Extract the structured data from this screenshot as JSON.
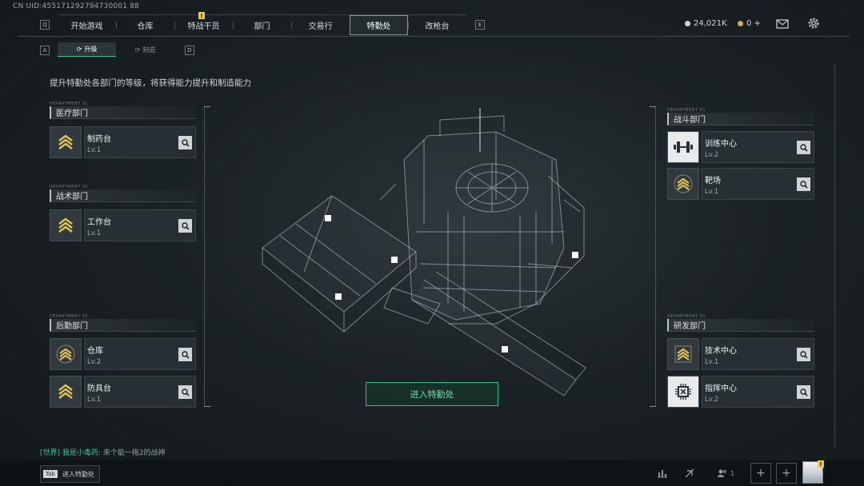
{
  "uid": "CN UID:455171292794730001 88",
  "keys": {
    "left_top": "Q",
    "right_top": "E",
    "left_sub": "A",
    "right_sub": "D"
  },
  "nav": {
    "tabs": [
      {
        "label": "开始游戏",
        "active": false,
        "badge": ""
      },
      {
        "label": "仓库",
        "active": false,
        "badge": ""
      },
      {
        "label": "特战干员",
        "active": false,
        "badge": "!"
      },
      {
        "label": "部门",
        "active": false,
        "badge": ""
      },
      {
        "label": "交易行",
        "active": false,
        "badge": ""
      },
      {
        "label": "特勤处",
        "active": true,
        "badge": ""
      },
      {
        "label": "改枪台",
        "active": false,
        "badge": ""
      }
    ]
  },
  "currency": {
    "silver": "24,021K",
    "gold": "0 +"
  },
  "subtabs": [
    {
      "label": "升级",
      "active": true
    },
    {
      "label": "制造",
      "active": false
    }
  ],
  "description": "提升特勤处各部门的等级，将获得能力提升和制造能力",
  "tag_text": "DEPARTMENT 01",
  "departments_left": [
    {
      "title": "医疗部门",
      "items": [
        {
          "name": "制药台",
          "level": "Lv.1",
          "icon": "chevron-rank-icon"
        }
      ]
    },
    {
      "title": "战术部门",
      "items": [
        {
          "name": "工作台",
          "level": "Lv.1",
          "icon": "chevron-rank-icon"
        }
      ]
    },
    {
      "title": "后勤部门",
      "items": [
        {
          "name": "仓库",
          "level": "Lv.2",
          "icon": "chevron-rank-icon"
        },
        {
          "name": "防具台",
          "level": "Lv.1",
          "icon": "chevron-rank-icon"
        }
      ]
    }
  ],
  "departments_right": [
    {
      "title": "战斗部门",
      "items": [
        {
          "name": "训练中心",
          "level": "Lv.2",
          "icon": "dumbbell-icon"
        },
        {
          "name": "靶场",
          "level": "Lv.1",
          "icon": "chevron-rank-icon"
        }
      ]
    },
    {
      "title": "研发部门",
      "items": [
        {
          "name": "技术中心",
          "level": "Lv.1",
          "icon": "chevron-rank-icon"
        },
        {
          "name": "指挥中心",
          "level": "Lv.2",
          "icon": "chip-icon"
        }
      ]
    }
  ],
  "enter_button": "进入特勤处",
  "chat": {
    "channel": "[世界]",
    "speaker": "我是小毒药:",
    "message": "来个能一拖2的战神"
  },
  "tab_hint": {
    "key": "Tab",
    "label": "进入特勤处"
  },
  "friends_count": "1",
  "colors": {
    "accent": "#3bc493",
    "badge": "#e6c84a",
    "rank": "#e3c15a"
  }
}
